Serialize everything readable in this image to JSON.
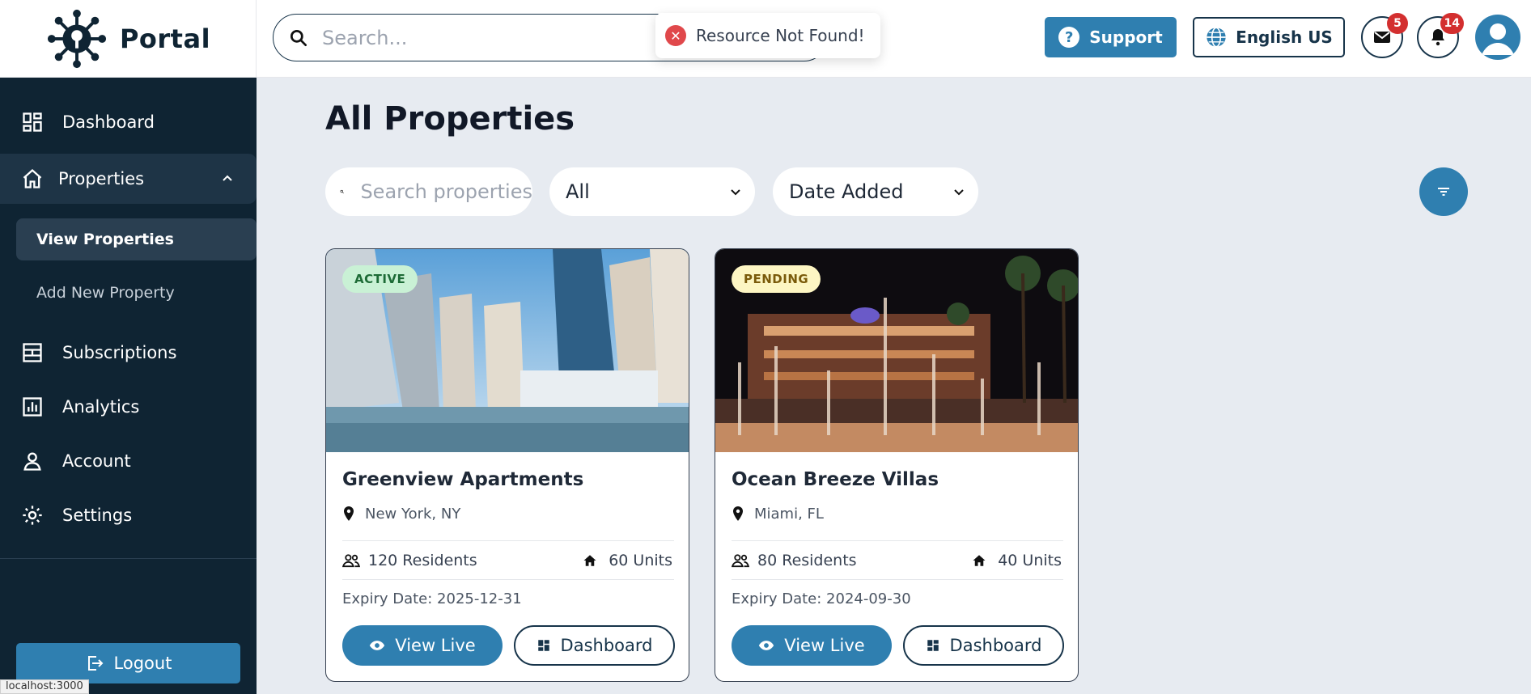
{
  "app": {
    "name": "Portal"
  },
  "header": {
    "search_placeholder": "Search...",
    "support_label": "Support",
    "language_label": "English US",
    "mail_count": "5",
    "notification_count": "14"
  },
  "toast": {
    "message": "Resource Not Found!"
  },
  "sidebar": {
    "dashboard": "Dashboard",
    "properties": "Properties",
    "view_properties": "View Properties",
    "add_property": "Add New Property",
    "subscriptions": "Subscriptions",
    "analytics": "Analytics",
    "account": "Account",
    "settings": "Settings",
    "logout": "Logout"
  },
  "status_bar": {
    "url": "localhost:3000"
  },
  "main": {
    "title": "All Properties",
    "search_placeholder": "Search properties",
    "status_filter": "All",
    "sort_filter": "Date Added"
  },
  "properties": [
    {
      "name": "Greenview Apartments",
      "status": "ACTIVE",
      "location": "New York, NY",
      "residents": "120 Residents",
      "units": "60 Units",
      "expiry": "Expiry Date: 2025-12-31",
      "view_label": "View Live",
      "dashboard_label": "Dashboard"
    },
    {
      "name": "Ocean Breeze Villas",
      "status": "PENDING",
      "location": "Miami, FL",
      "residents": "80 Residents",
      "units": "40 Units",
      "expiry": "Expiry Date: 2024-09-30",
      "view_label": "View Live",
      "dashboard_label": "Dashboard"
    }
  ],
  "colors": {
    "primary": "#2f7fb0",
    "navy": "#0f2433",
    "error": "#e0484b",
    "active_badge": "#c9f1d5",
    "pending_badge": "#fdf6c3"
  }
}
